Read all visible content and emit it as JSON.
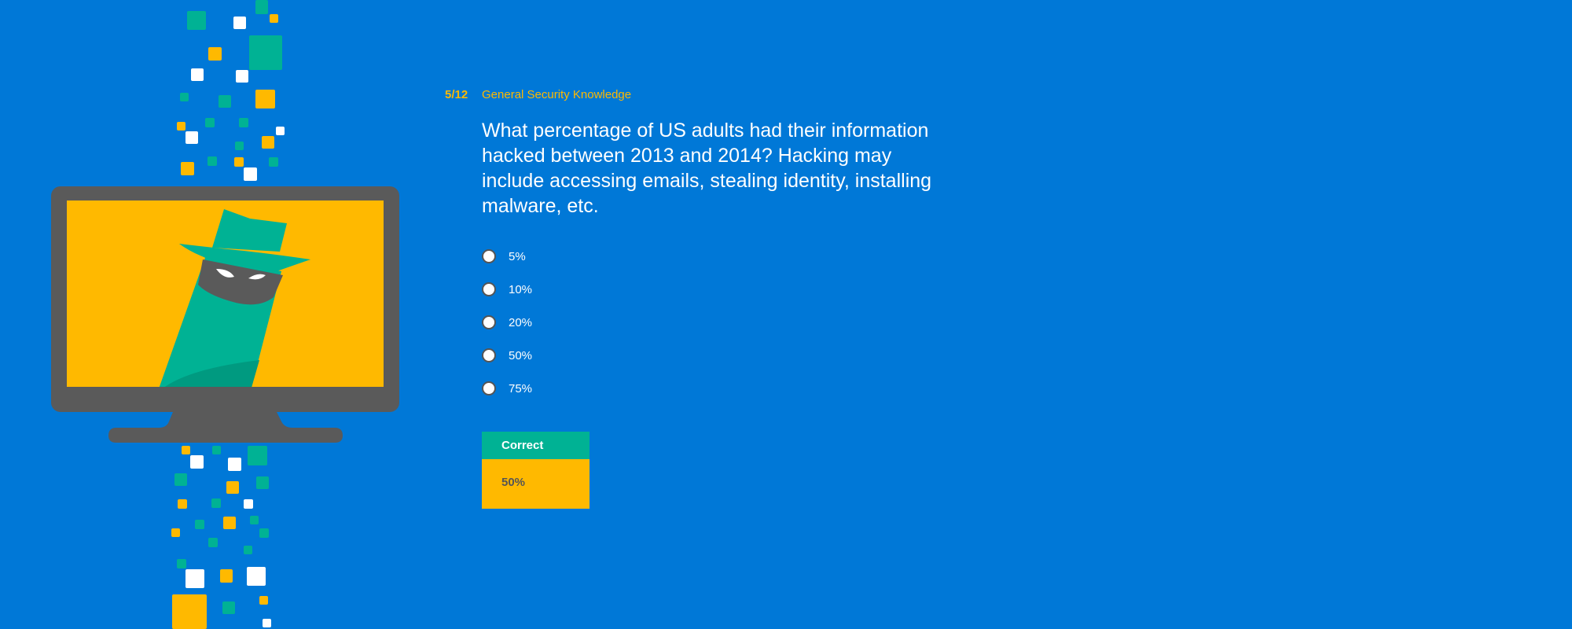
{
  "quiz": {
    "progress": "5/12",
    "category": "General Security Knowledge",
    "question": "What percentage of US adults had their information hacked between 2013 and 2014? Hacking may include accessing emails, stealing identity, installing malware, etc.",
    "options": [
      "5%",
      "10%",
      "20%",
      "50%",
      "75%"
    ]
  },
  "result": {
    "status_label": "Correct",
    "answer": "50%"
  },
  "illustration": {
    "icon": "hacker-monitor-icon",
    "colors": {
      "background": "#0078D7",
      "accent_yellow": "#FFB900",
      "accent_teal": "#00B294",
      "monitor_gray": "#5A5A5A",
      "white": "#FFFFFF"
    }
  }
}
